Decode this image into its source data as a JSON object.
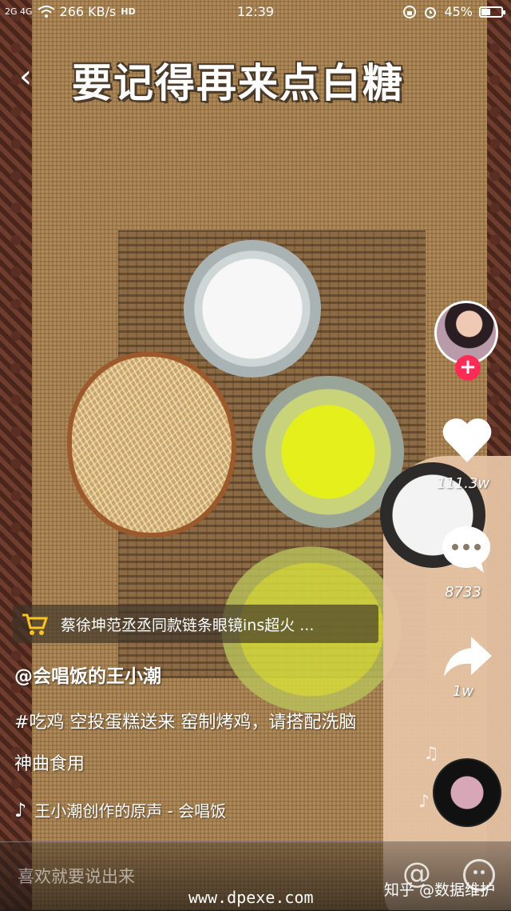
{
  "status_bar": {
    "network": "2G 4G",
    "speed": "266 KB/s",
    "hd": "HD",
    "time": "12:39",
    "battery": "45%",
    "battery_level": 0.45
  },
  "video": {
    "title": "要记得再来点白糖"
  },
  "actions": {
    "likes": "111.3w",
    "comments": "8733",
    "shares": "1w",
    "follow": "+"
  },
  "product": {
    "text": "蔡徐坤范丞丞同款链条眼镜ins超火 ..."
  },
  "post": {
    "author": "@会唱饭的王小潮",
    "description": "#吃鸡 空投蛋糕送来 窑制烤鸡，请搭配洗脑神曲食用",
    "music": "王小潮创作的原声 - 会唱饭"
  },
  "comment_bar": {
    "placeholder": "喜欢就要说出来",
    "at": "@"
  },
  "watermarks": {
    "left": "www.dpexe.com",
    "right": "知乎 @数据维护"
  },
  "icons": [
    "back-arrow-icon",
    "cart-icon",
    "heart-icon",
    "comment-icon",
    "share-icon",
    "music-note-icon",
    "emoji-icon"
  ],
  "colors": {
    "follow_button": "#fe2c55",
    "product_bar": "#3c3228"
  }
}
